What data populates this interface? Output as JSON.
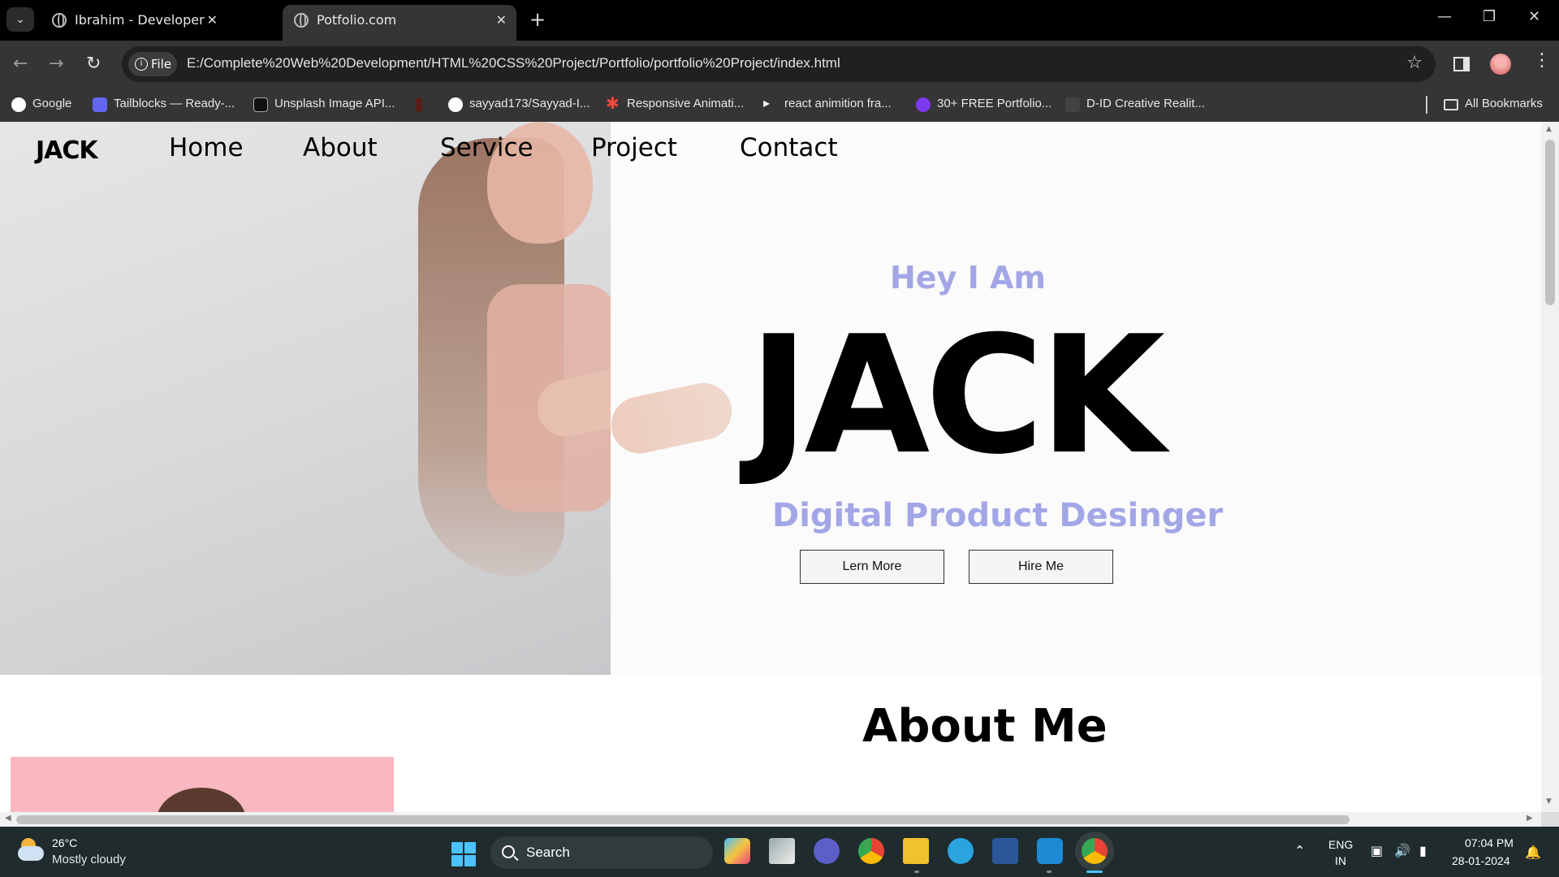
{
  "browser": {
    "tabs": [
      {
        "title": "Ibrahim - Developer Portfolio"
      },
      {
        "title": "Potfolio.com"
      }
    ],
    "new_tab_label": "+",
    "address_chip": "File",
    "url": "E:/Complete%20Web%20Development/HTML%20CSS%20Project/Portfolio/portfolio%20Project/index.html",
    "bookmarks": [
      {
        "label": "Google",
        "icon": "google-icon",
        "color": "#ffffff"
      },
      {
        "label": "Tailblocks — Ready-...",
        "icon": "tailblocks-icon",
        "color": "#6366f1"
      },
      {
        "label": "Unsplash Image API...",
        "icon": "unsplash-icon",
        "color": "#111111"
      },
      {
        "label": "",
        "icon": "fire-icon",
        "color": "#e8442d"
      },
      {
        "label": "sayyad173/Sayyad-I...",
        "icon": "github-icon",
        "color": "#ffffff"
      },
      {
        "label": "Responsive Animati...",
        "icon": "asterisk-icon",
        "color": "#ef4a3c"
      },
      {
        "label": "react animition  fra...",
        "icon": "framer-icon",
        "color": "#ffffff"
      },
      {
        "label": "30+ FREE Portfolio...",
        "icon": "portfolio-icon",
        "color": "#7c3aed"
      },
      {
        "label": "D-ID Creative Realit...",
        "icon": "did-icon",
        "color": "#444444"
      }
    ],
    "all_bookmarks": "All Bookmarks"
  },
  "page": {
    "brand": "JACK",
    "nav": [
      "Home",
      "About",
      "Service",
      "Project",
      "Contact"
    ],
    "hero": {
      "greeting": "Hey I Am",
      "name": "JACK",
      "role": "Digital Product Desinger",
      "primary_button": "Lern More",
      "secondary_button": "Hire Me",
      "accent_color": "#a3a6e6"
    },
    "about_title": "About Me"
  },
  "taskbar": {
    "temperature": "26°C",
    "weather": "Mostly cloudy",
    "search_placeholder": "Search",
    "language_top": "ENG",
    "language_bottom": "IN",
    "time": "07:04 PM",
    "date": "28-01-2024"
  }
}
